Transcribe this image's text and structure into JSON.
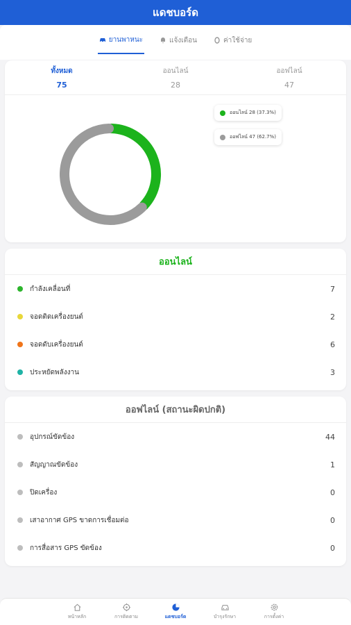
{
  "appbar": {
    "title": "แดชบอร์ด"
  },
  "tabs": [
    {
      "label": "ยานพาหนะ",
      "icon": "car-icon"
    },
    {
      "label": "แจ้งเตือน",
      "icon": "bell-icon"
    },
    {
      "label": "ค่าใช้จ่าย",
      "icon": "coin-icon"
    }
  ],
  "summary": {
    "total_label": "ทั้งหมด",
    "total_value": "75",
    "online_label": "ออนไลน์",
    "online_value": "28",
    "offline_label": "ออฟไลน์",
    "offline_value": "47"
  },
  "chart_data": {
    "type": "pie",
    "categories": [
      "ออนไลน์",
      "ออฟไลน์"
    ],
    "values": [
      28,
      47
    ],
    "colors": [
      "#1cb31c",
      "#9b9b9b"
    ],
    "legend": [
      "ออนไลน์ 28 (37.3%)",
      "ออฟไลน์ 47 (62.7%)"
    ]
  },
  "online": {
    "title": "ออนไลน์",
    "rows": [
      {
        "label": "กำลังเคลื่อนที่",
        "value": "7",
        "color": "#2db52d"
      },
      {
        "label": "จอดติดเครื่องยนต์",
        "value": "2",
        "color": "#e8d73a"
      },
      {
        "label": "จอดดับเครื่องยนต์",
        "value": "6",
        "color": "#f0751a"
      },
      {
        "label": "ประหยัดพลังงาน",
        "value": "3",
        "color": "#1fb3a6"
      }
    ]
  },
  "offline": {
    "title": "ออฟไลน์ (สถานะผิดปกติ)",
    "rows": [
      {
        "label": "อุปกรณ์ขัดข้อง",
        "value": "44",
        "color": "#bdbdbd"
      },
      {
        "label": "สัญญาณขัดข้อง",
        "value": "1",
        "color": "#bdbdbd"
      },
      {
        "label": "ปิดเครื่อง",
        "value": "0",
        "color": "#bdbdbd"
      },
      {
        "label": "เสาอากาศ GPS ขาดการเชื่อมต่อ",
        "value": "0",
        "color": "#bdbdbd"
      },
      {
        "label": "การสื่อสาร GPS ขัดข้อง",
        "value": "0",
        "color": "#bdbdbd"
      }
    ]
  },
  "bottom_nav": [
    {
      "label": "หน้าหลัก",
      "icon": "home-icon"
    },
    {
      "label": "การติดตาม",
      "icon": "tracking-icon"
    },
    {
      "label": "แดชบอร์ด",
      "icon": "dashboard-icon"
    },
    {
      "label": "บำรุงรักษา",
      "icon": "maintenance-icon"
    },
    {
      "label": "การตั้งค่า",
      "icon": "settings-icon"
    }
  ],
  "accent_color": "#1f5fd6"
}
